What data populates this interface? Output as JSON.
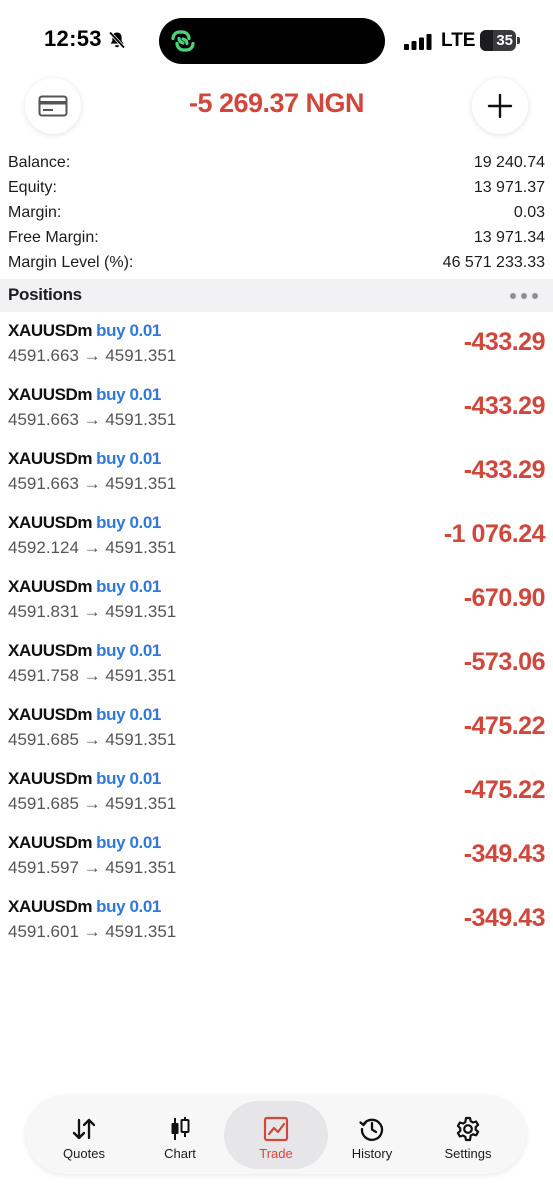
{
  "status_bar": {
    "time": "12:53",
    "network": "LTE",
    "battery": "35"
  },
  "header": {
    "total": "-5 269.37 NGN",
    "left_icon": "card-icon",
    "right_icon": "plus-icon"
  },
  "summary": [
    {
      "label": "Balance:",
      "value": "19 240.74"
    },
    {
      "label": "Equity:",
      "value": "13 971.37"
    },
    {
      "label": "Margin:",
      "value": "0.03"
    },
    {
      "label": "Free Margin:",
      "value": "13 971.34"
    },
    {
      "label": "Margin Level (%):",
      "value": "46 571 233.33"
    }
  ],
  "positions": {
    "title": "Positions",
    "items": [
      {
        "symbol": "XAUUSDm",
        "side": "buy 0.01",
        "prices": "4591.663 → 4591.351",
        "profit": "-433.29"
      },
      {
        "symbol": "XAUUSDm",
        "side": "buy 0.01",
        "prices": "4591.663 → 4591.351",
        "profit": "-433.29"
      },
      {
        "symbol": "XAUUSDm",
        "side": "buy 0.01",
        "prices": "4591.663 → 4591.351",
        "profit": "-433.29"
      },
      {
        "symbol": "XAUUSDm",
        "side": "buy 0.01",
        "prices": "4592.124 → 4591.351",
        "profit": "-1 076.24"
      },
      {
        "symbol": "XAUUSDm",
        "side": "buy 0.01",
        "prices": "4591.831 → 4591.351",
        "profit": "-670.90"
      },
      {
        "symbol": "XAUUSDm",
        "side": "buy 0.01",
        "prices": "4591.758 → 4591.351",
        "profit": "-573.06"
      },
      {
        "symbol": "XAUUSDm",
        "side": "buy 0.01",
        "prices": "4591.685 → 4591.351",
        "profit": "-475.22"
      },
      {
        "symbol": "XAUUSDm",
        "side": "buy 0.01",
        "prices": "4591.685 → 4591.351",
        "profit": "-475.22"
      },
      {
        "symbol": "XAUUSDm",
        "side": "buy 0.01",
        "prices": "4591.597 → 4591.351",
        "profit": "-349.43"
      },
      {
        "symbol": "XAUUSDm",
        "side": "buy 0.01",
        "prices": "4591.601 → 4591.351",
        "profit": "-349.43"
      }
    ]
  },
  "tabs": [
    {
      "label": "Quotes",
      "icon": "quotes-arrows-icon",
      "active": false
    },
    {
      "label": "Chart",
      "icon": "candlestick-icon",
      "active": false
    },
    {
      "label": "Trade",
      "icon": "trade-chart-icon",
      "active": true
    },
    {
      "label": "History",
      "icon": "history-clock-icon",
      "active": false
    },
    {
      "label": "Settings",
      "icon": "gear-icon",
      "active": false
    }
  ],
  "colors": {
    "loss": "#d1473b",
    "buy": "#2f7ad6",
    "active_tab_bg": "#e6e6e9"
  }
}
